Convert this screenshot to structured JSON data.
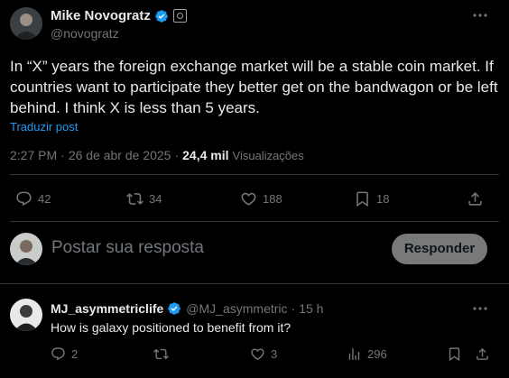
{
  "post": {
    "author_name": "Mike Novogratz",
    "author_handle": "@novogratz",
    "text_lines": [
      "In “X” years the foreign exchange market will be a stable coin market.   If",
      "countries want to participate they better get on the bandwagon or be left",
      "behind.   I think X is less than 5 years."
    ],
    "translate_label": "Traduzir post",
    "time": "2:27 PM",
    "date": "26 de abr de 2025",
    "views_count": "24,4 mil",
    "views_label": "Visualizações",
    "separator": "·",
    "stats": {
      "replies": "42",
      "reposts": "34",
      "likes": "188",
      "bookmarks": "18"
    }
  },
  "composer": {
    "placeholder": "Postar sua resposta",
    "reply_button": "Responder"
  },
  "reply": {
    "author_name": "MJ_asymmetriclife",
    "author_handle": "@MJ_asymmetric",
    "time": "15 h",
    "separator": "·",
    "text": "How is galaxy positioned to benefit from it?",
    "stats": {
      "replies": "2",
      "likes": "3",
      "views": "296"
    }
  },
  "colors": {
    "background": "#000000",
    "text": "#e7e9ea",
    "muted": "#71767b",
    "accent": "#1d9bf0",
    "divider": "#2f3336"
  }
}
